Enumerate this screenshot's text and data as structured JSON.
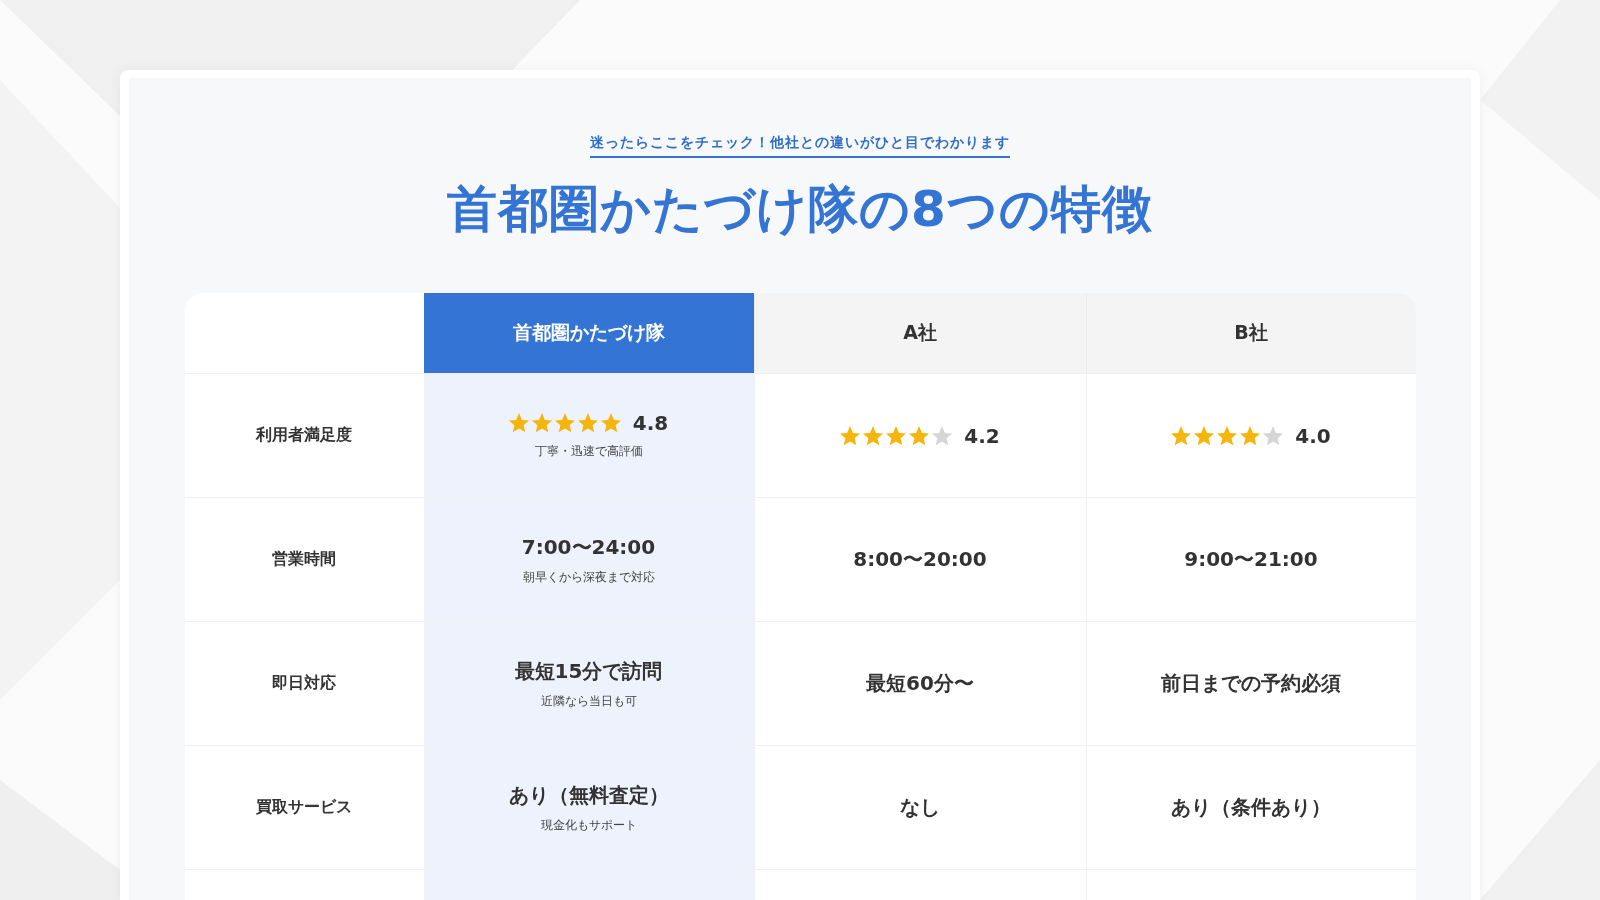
{
  "heading": {
    "lead": "迷ったらここをチェック！他社との違いがひと目でわかります",
    "title": "首都圏かたづけ隊の8つの特徴"
  },
  "table": {
    "columns": [
      {
        "label": "首都圏かたづけ隊",
        "highlighted": true
      },
      {
        "label": "A社",
        "highlighted": false
      },
      {
        "label": "B社",
        "highlighted": false
      }
    ],
    "rows": [
      {
        "label": "利用者満足度",
        "cells": [
          {
            "kind": "rating",
            "stars": 5,
            "score": "4.8",
            "note": "丁寧・迅速で高評価"
          },
          {
            "kind": "rating",
            "stars": 4,
            "score": "4.2"
          },
          {
            "kind": "rating",
            "stars": 4,
            "score": "4.0"
          }
        ]
      },
      {
        "label": "営業時間",
        "cells": [
          {
            "kind": "text",
            "value": "7:00〜24:00",
            "note": "朝早くから深夜まで対応"
          },
          {
            "kind": "text",
            "value": "8:00〜20:00"
          },
          {
            "kind": "text",
            "value": "9:00〜21:00"
          }
        ]
      },
      {
        "label": "即日対応",
        "cells": [
          {
            "kind": "text",
            "value": "最短15分で訪問",
            "note": "近隣なら当日も可"
          },
          {
            "kind": "text",
            "value": "最短60分〜"
          },
          {
            "kind": "text",
            "value": "前日までの予約必須"
          }
        ]
      },
      {
        "label": "買取サービス",
        "cells": [
          {
            "kind": "text",
            "value": "あり（無料査定）",
            "note": "現金化もサポート"
          },
          {
            "kind": "text",
            "value": "なし"
          },
          {
            "kind": "text",
            "value": "あり（条件あり）"
          }
        ]
      }
    ]
  }
}
